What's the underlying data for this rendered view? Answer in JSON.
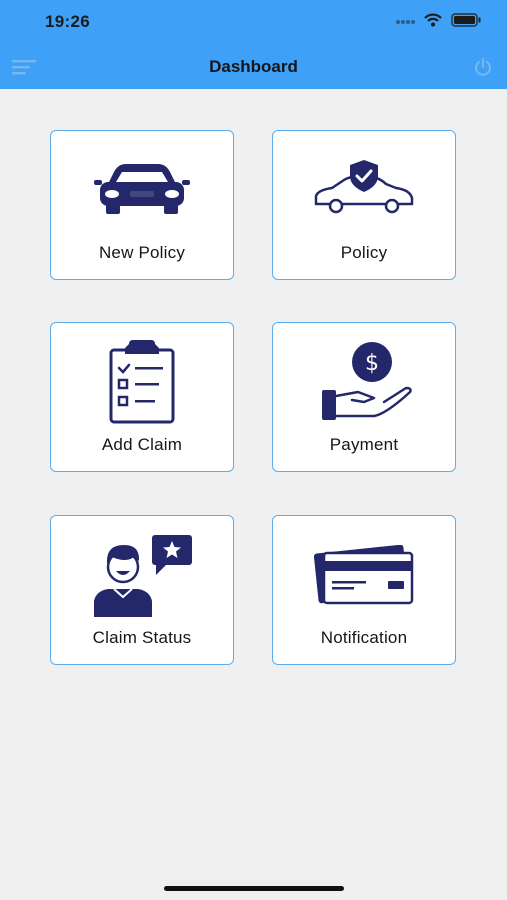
{
  "status_bar": {
    "time": "19:26"
  },
  "header": {
    "title": "Dashboard"
  },
  "cards": [
    {
      "label": "New Policy",
      "icon": "car-front-icon"
    },
    {
      "label": "Policy",
      "icon": "car-shield-icon"
    },
    {
      "label": "Add Claim",
      "icon": "clipboard-checklist-icon"
    },
    {
      "label": "Payment",
      "icon": "hand-dollar-icon"
    },
    {
      "label": "Claim Status",
      "icon": "person-star-bubble-icon"
    },
    {
      "label": "Notification",
      "icon": "credit-card-icon"
    }
  ],
  "colors": {
    "header": "#3ea0f6",
    "card_border": "#5aaef0",
    "icon_navy": "#24286a",
    "background": "#f0f0f0"
  }
}
